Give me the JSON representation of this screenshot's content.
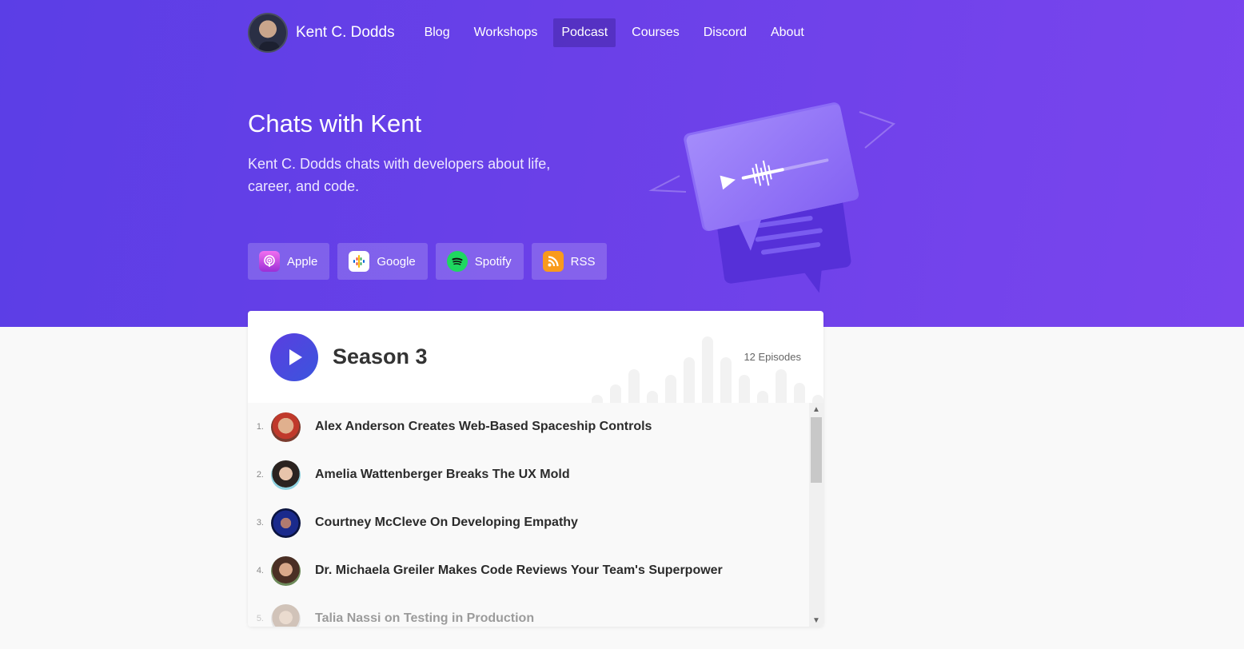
{
  "nav": {
    "brand": "Kent C. Dodds",
    "links": [
      {
        "label": "Blog",
        "active": false
      },
      {
        "label": "Workshops",
        "active": false
      },
      {
        "label": "Podcast",
        "active": true
      },
      {
        "label": "Courses",
        "active": false
      },
      {
        "label": "Discord",
        "active": false
      },
      {
        "label": "About",
        "active": false
      }
    ]
  },
  "hero": {
    "title": "Chats with Kent",
    "description": "Kent C. Dodds chats with developers about life, career, and code."
  },
  "platforms": [
    {
      "label": "Apple",
      "icon": "apple-podcasts-icon"
    },
    {
      "label": "Google",
      "icon": "google-podcasts-icon"
    },
    {
      "label": "Spotify",
      "icon": "spotify-icon"
    },
    {
      "label": "RSS",
      "icon": "rss-icon"
    }
  ],
  "season": {
    "title": "Season 3",
    "episode_count": "12 Episodes",
    "episodes": [
      {
        "number": "1.",
        "title": "Alex Anderson Creates Web-Based Spaceship Controls"
      },
      {
        "number": "2.",
        "title": "Amelia Wattenberger Breaks The UX Mold"
      },
      {
        "number": "3.",
        "title": "Courtney McCleve On Developing Empathy"
      },
      {
        "number": "4.",
        "title": "Dr. Michaela Greiler Makes Code Reviews Your Team's Superpower"
      },
      {
        "number": "5.",
        "title": "Talia Nassi on Testing in Production"
      }
    ]
  },
  "colors": {
    "hero_start": "#5b3ee6",
    "hero_end": "#7a45ee",
    "accent": "#5a3ee0"
  }
}
